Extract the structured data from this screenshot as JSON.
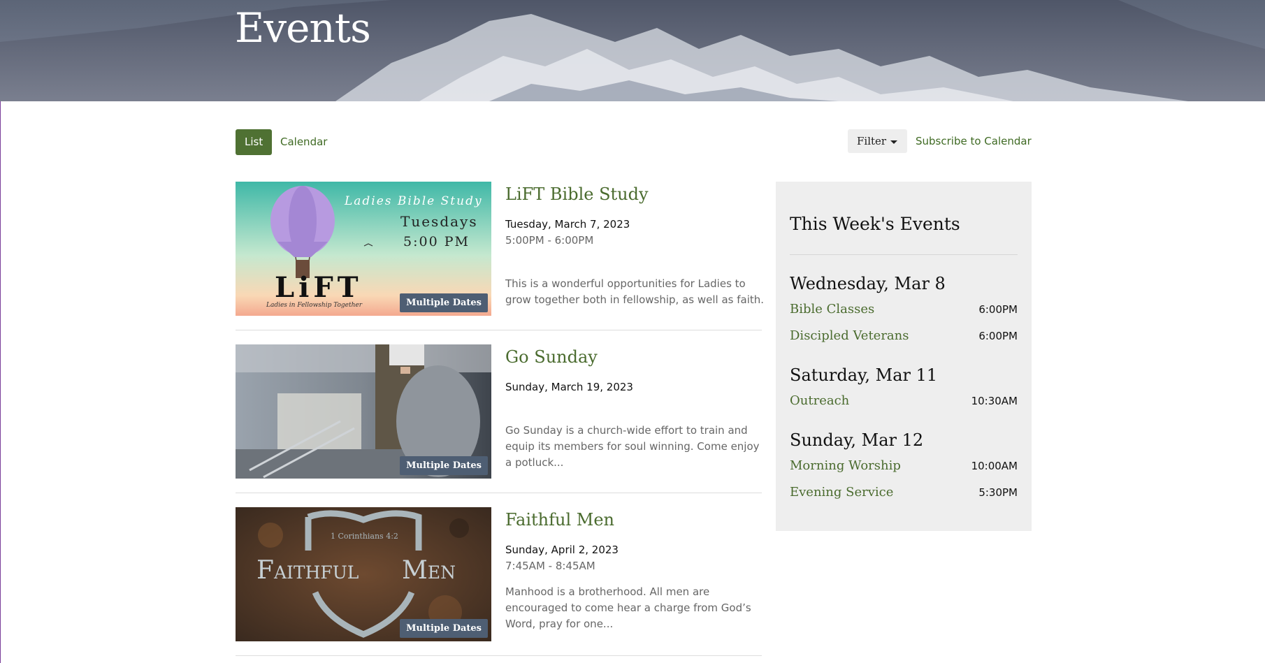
{
  "page_title": "Events",
  "views": {
    "list": "List",
    "calendar": "Calendar"
  },
  "filter_label": "Filter",
  "subscribe_label": "Subscribe to Calendar",
  "events": [
    {
      "title": "LiFT Bible Study",
      "date": "Tuesday, March 7, 2023",
      "time": "5:00PM - 6:00PM",
      "description": "This is a wonderful opportunities for Ladies to grow together both in fellowship, as well as faith.",
      "badge": "Multiple Dates",
      "image": {
        "line1": "Ladies Bible Study",
        "line2": "Tuesdays",
        "line3": "5:00 PM",
        "logo": "LiFT",
        "tagline": "Ladies in Fellowship Together"
      }
    },
    {
      "title": "Go Sunday",
      "date": "Sunday, March 19, 2023",
      "time": "",
      "description": "Go Sunday is a church-wide effort to train and equip its members for soul winning. Come enjoy a potluck...",
      "badge": "Multiple Dates"
    },
    {
      "title": "Faithful Men",
      "date": "Sunday, April 2, 2023",
      "time": "7:45AM - 8:45AM",
      "description": "Manhood is a brotherhood. All men are encouraged to come hear a charge from God’s Word, pray for one...",
      "badge": "Multiple Dates",
      "image": {
        "verse": "1 Corinthians 4:2",
        "word1": "Faithful",
        "word2": "Men"
      }
    }
  ],
  "sidebar": {
    "title": "This Week's Events",
    "days": [
      {
        "label": "Wednesday, Mar 8",
        "items": [
          {
            "name": "Bible Classes",
            "time": "6:00PM"
          },
          {
            "name": "Discipled Veterans",
            "time": "6:00PM"
          }
        ]
      },
      {
        "label": "Saturday, Mar 11",
        "items": [
          {
            "name": "Outreach",
            "time": "10:30AM"
          }
        ]
      },
      {
        "label": "Sunday, Mar 12",
        "items": [
          {
            "name": "Morning Worship",
            "time": "10:00AM"
          },
          {
            "name": "Evening Service",
            "time": "5:30PM"
          }
        ]
      }
    ]
  },
  "colors": {
    "accent": "#4f7133",
    "link": "#4a6b2e",
    "badge": "#4e5e73",
    "sidebar_bg": "#eeeeee"
  }
}
